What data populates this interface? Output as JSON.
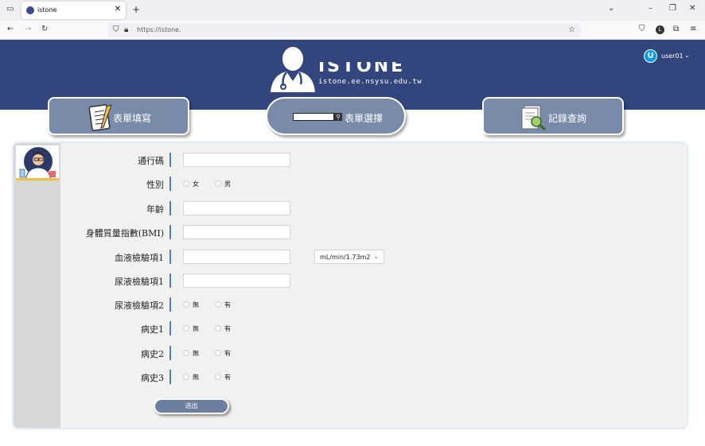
{
  "browser": {
    "tab_title": "istone",
    "url": "https://istone."
  },
  "header": {
    "logo_title": "ISTONE",
    "logo_subtitle": "istone.ee.nsysu.edu.tw",
    "user_initial": "U",
    "user_name": "user01",
    "bg_color": "#33457d"
  },
  "nav": {
    "fill_form": "表單填寫",
    "select_form": "表單選擇",
    "record_query": "記錄查詢"
  },
  "form": {
    "fields": {
      "passcode": "通行碼",
      "gender": "性別",
      "age": "年齡",
      "bmi": "身體質量指數(BMI)",
      "blood1": "血液檢驗項1",
      "urine1": "尿液檢驗項1",
      "urine2": "尿液檢驗項2",
      "history1": "病史1",
      "history2": "病史2",
      "history3": "病史3"
    },
    "gender_options": [
      "女",
      "男"
    ],
    "yes_no_options": [
      "無",
      "有"
    ],
    "blood1_unit": "mL/min/1.73m2",
    "submit_label": "送出"
  }
}
